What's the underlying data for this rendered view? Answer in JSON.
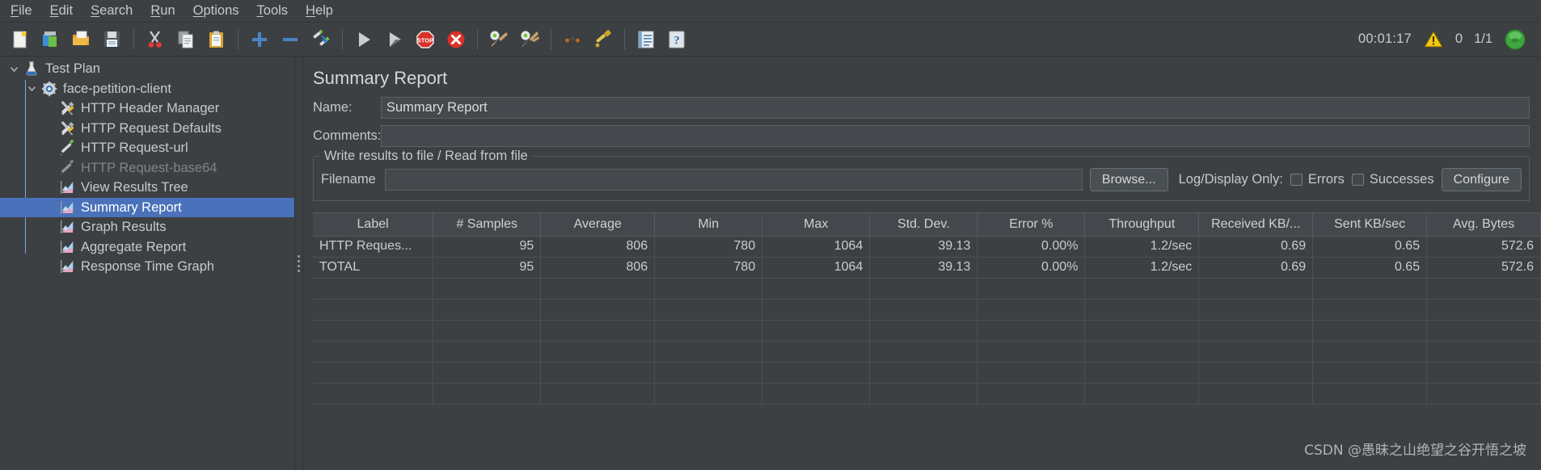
{
  "menu": {
    "items": [
      {
        "label": "File",
        "mnemonic": "F"
      },
      {
        "label": "Edit",
        "mnemonic": "E"
      },
      {
        "label": "Search",
        "mnemonic": "S"
      },
      {
        "label": "Run",
        "mnemonic": "R"
      },
      {
        "label": "Options",
        "mnemonic": "O"
      },
      {
        "label": "Tools",
        "mnemonic": "T"
      },
      {
        "label": "Help",
        "mnemonic": "H"
      }
    ]
  },
  "toolbar": {
    "buttons": [
      {
        "name": "new-icon",
        "title": "New"
      },
      {
        "name": "templates-icon",
        "title": "Templates"
      },
      {
        "name": "open-icon",
        "title": "Open"
      },
      {
        "name": "save-icon",
        "title": "Save"
      },
      {
        "name": "cut-icon",
        "title": "Cut"
      },
      {
        "name": "copy-icon",
        "title": "Copy"
      },
      {
        "name": "paste-icon",
        "title": "Paste"
      },
      {
        "name": "expand-all-icon",
        "title": "Expand All"
      },
      {
        "name": "collapse-all-icon",
        "title": "Collapse All"
      },
      {
        "name": "toggle-icon",
        "title": "Toggle"
      },
      {
        "name": "start-icon",
        "title": "Start"
      },
      {
        "name": "start-no-timers-icon",
        "title": "Start no pauses"
      },
      {
        "name": "stop-icon",
        "title": "Stop"
      },
      {
        "name": "shutdown-icon",
        "title": "Shutdown"
      },
      {
        "name": "clear-icon",
        "title": "Clear"
      },
      {
        "name": "clear-all-icon",
        "title": "Clear All"
      },
      {
        "name": "search-icon",
        "title": "Search"
      },
      {
        "name": "search-reset-icon",
        "title": "Reset Search"
      },
      {
        "name": "function-helper-icon",
        "title": "Function Helper Dialog"
      },
      {
        "name": "help-icon",
        "title": "Help"
      }
    ],
    "status": {
      "elapsed": "00:01:17",
      "warning_count": "0",
      "threads": "1/1",
      "run_indicator_color": "#3fa63f",
      "warning_color": "#f2c811"
    }
  },
  "tree": {
    "nodes": [
      {
        "label": "Test Plan",
        "depth": 0,
        "icon": "test-plan-icon",
        "expanded": true,
        "selected": false,
        "disabled": false
      },
      {
        "label": "face-petition-client",
        "depth": 1,
        "icon": "thread-group-icon",
        "expanded": true,
        "selected": false,
        "disabled": false
      },
      {
        "label": "HTTP Header Manager",
        "depth": 2,
        "icon": "config-element-icon",
        "expanded": null,
        "selected": false,
        "disabled": false
      },
      {
        "label": "HTTP Request Defaults",
        "depth": 2,
        "icon": "config-element-icon",
        "expanded": null,
        "selected": false,
        "disabled": false
      },
      {
        "label": "HTTP Request-url",
        "depth": 2,
        "icon": "sampler-icon",
        "expanded": null,
        "selected": false,
        "disabled": false
      },
      {
        "label": "HTTP Request-base64",
        "depth": 2,
        "icon": "sampler-icon",
        "expanded": null,
        "selected": false,
        "disabled": true
      },
      {
        "label": "View Results Tree",
        "depth": 2,
        "icon": "listener-icon",
        "expanded": null,
        "selected": false,
        "disabled": false
      },
      {
        "label": "Summary Report",
        "depth": 2,
        "icon": "listener-icon",
        "expanded": null,
        "selected": true,
        "disabled": false
      },
      {
        "label": "Graph Results",
        "depth": 2,
        "icon": "listener-icon",
        "expanded": null,
        "selected": false,
        "disabled": false
      },
      {
        "label": "Aggregate Report",
        "depth": 2,
        "icon": "listener-icon",
        "expanded": null,
        "selected": false,
        "disabled": false
      },
      {
        "label": "Response Time Graph",
        "depth": 2,
        "icon": "listener-icon",
        "expanded": null,
        "selected": false,
        "disabled": false
      }
    ],
    "selection_color": "#4a72ba"
  },
  "panel": {
    "title": "Summary Report",
    "name_label": "Name:",
    "name_value": "Summary Report",
    "name_placeholder": "",
    "comments_label": "Comments:",
    "comments_value": "",
    "comments_placeholder": "",
    "group_legend": "Write results to file / Read from file",
    "filename_label": "Filename",
    "filename_value": "",
    "filename_placeholder": "",
    "browse_label": "Browse...",
    "log_display_label": "Log/Display Only:",
    "errors_label": "Errors",
    "errors_checked": false,
    "successes_label": "Successes",
    "successes_checked": false,
    "configure_label": "Configure"
  },
  "table": {
    "columns": [
      "Label",
      "# Samples",
      "Average",
      "Min",
      "Max",
      "Std. Dev.",
      "Error %",
      "Throughput",
      "Received KB/...",
      "Sent KB/sec",
      "Avg. Bytes"
    ],
    "rows": [
      [
        "HTTP Reques...",
        "95",
        "806",
        "780",
        "1064",
        "39.13",
        "0.00%",
        "1.2/sec",
        "0.69",
        "0.65",
        "572.6"
      ],
      [
        "TOTAL",
        "95",
        "806",
        "780",
        "1064",
        "39.13",
        "0.00%",
        "1.2/sec",
        "0.69",
        "0.65",
        "572.6"
      ]
    ],
    "empty_row_count": 6
  },
  "watermark": {
    "text": "CSDN @愚昧之山绝望之谷开悟之坡"
  }
}
